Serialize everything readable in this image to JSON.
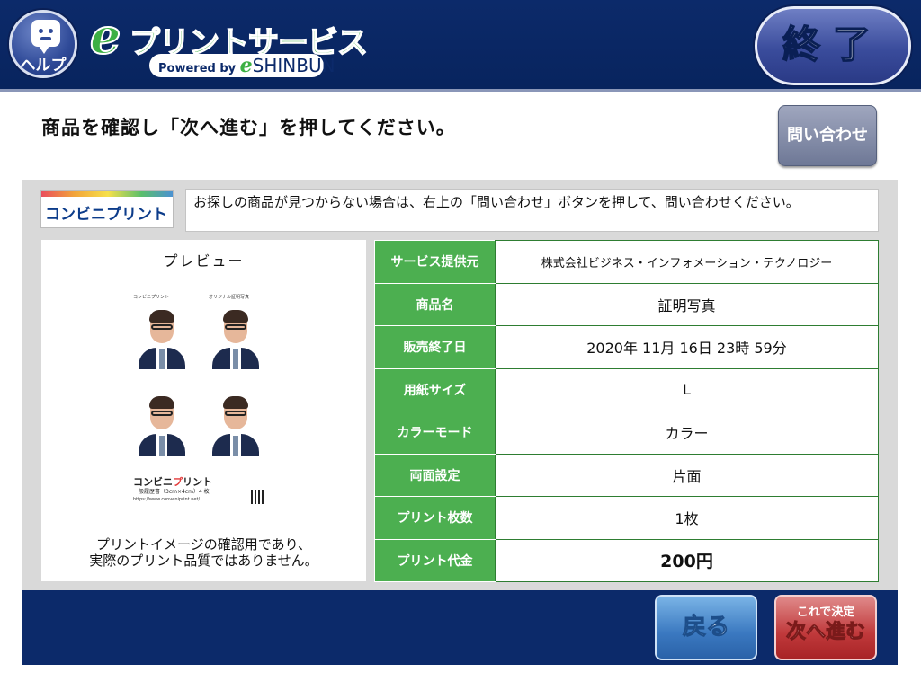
{
  "header": {
    "help_label": "ヘルプ",
    "logo_e": "e",
    "logo_title": "プリントサービス",
    "logo_powered": "Powered by",
    "logo_powered_e": "e",
    "logo_powered_brand": "SHINBUN",
    "end_label": "終了"
  },
  "main": {
    "instruction": "商品を確認し「次へ進む」を押してください。",
    "inquiry_label": "問い合わせ",
    "brand_badge": "コンビニプリント",
    "notice": "お探しの商品が見つからない場合は、右上の「問い合わせ」ボタンを押して、問い合わせください。"
  },
  "preview": {
    "title": "プレビュー",
    "sheet_brand_a": "コンビニ",
    "sheet_brand_b": "プ",
    "sheet_brand_c": "リント",
    "sheet_sub": "一般履歴書（3cm×4cm）4 枚",
    "sheet_url": "https://www.conveniprint.net/",
    "sheet_corner_left": "コンビニプリント",
    "sheet_corner_right": "オリジナル証明写真",
    "note_line1": "プリントイメージの確認用であり、",
    "note_line2": "実際のプリント品質ではありません。"
  },
  "details": [
    {
      "label": "サービス提供元",
      "value": "株式会社ビジネス・インフォメーション・テクノロジー"
    },
    {
      "label": "商品名",
      "value": "証明写真"
    },
    {
      "label": "販売終了日",
      "value": "2020年 11月 16日 23時 59分"
    },
    {
      "label": "用紙サイズ",
      "value": "L"
    },
    {
      "label": "カラーモード",
      "value": "カラー"
    },
    {
      "label": "両面設定",
      "value": "片面"
    },
    {
      "label": "プリント枚数",
      "value": "1枚"
    },
    {
      "label": "プリント代金",
      "value": "200円"
    }
  ],
  "footer": {
    "back_label": "戻る",
    "next_small": "これで決定",
    "next_large": "次へ進む"
  },
  "colors": {
    "header_bg": "#0c2a6a",
    "accent_green": "#4caf50",
    "next_red": "#c0393b",
    "back_blue": "#3a78c0"
  },
  "icons": [
    "help-speech-bubble-icon",
    "qr-code-icon"
  ]
}
